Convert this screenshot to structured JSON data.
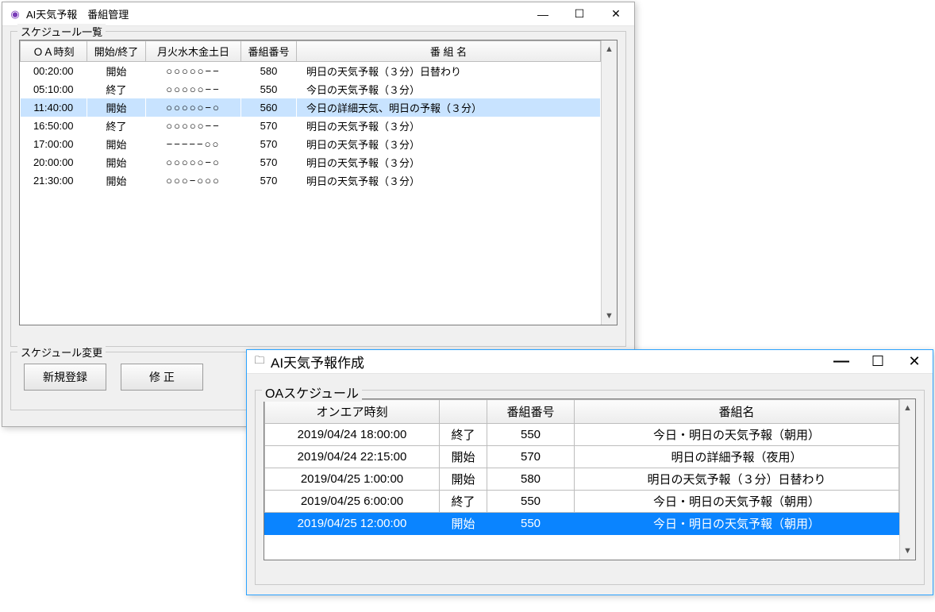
{
  "win1": {
    "title": "AI天気予報　番組管理",
    "group1_legend": "スケジュール一覧",
    "group2_legend": "スケジュール変更",
    "headers": {
      "time": "ＯＡ時刻",
      "se": "開始/終了",
      "days": "月火水木金土日",
      "pno": "番組番号",
      "pname": "番 組 名"
    },
    "rows": [
      {
        "time": "00:20:00",
        "se": "開始",
        "days": "○○○○○−−",
        "pno": "580",
        "pname": "明日の天気予報（３分）日替わり"
      },
      {
        "time": "05:10:00",
        "se": "終了",
        "days": "○○○○○−−",
        "pno": "550",
        "pname": "今日の天気予報（３分）"
      },
      {
        "time": "11:40:00",
        "se": "開始",
        "days": "○○○○○−○",
        "pno": "560",
        "pname": "今日の詳細天気、明日の予報（３分）"
      },
      {
        "time": "16:50:00",
        "se": "終了",
        "days": "○○○○○−−",
        "pno": "570",
        "pname": "明日の天気予報（３分）"
      },
      {
        "time": "17:00:00",
        "se": "開始",
        "days": "−−−−−○○",
        "pno": "570",
        "pname": "明日の天気予報（３分）"
      },
      {
        "time": "20:00:00",
        "se": "開始",
        "days": "○○○○○−○",
        "pno": "570",
        "pname": "明日の天気予報（３分）"
      },
      {
        "time": "21:30:00",
        "se": "開始",
        "days": "○○○−○○○",
        "pno": "570",
        "pname": "明日の天気予報（３分）"
      }
    ],
    "selected_row_index": 2,
    "buttons": {
      "new": "新規登録",
      "edit": "修 正"
    }
  },
  "win2": {
    "title": "AI天気予報作成",
    "group_legend": "OAスケジュール",
    "headers": {
      "oat": "オンエア時刻",
      "se": "",
      "pno": "番組番号",
      "pname": "番組名"
    },
    "rows": [
      {
        "oat": "2019/04/24 18:00:00",
        "se": "終了",
        "pno": "550",
        "pname": "今日・明日の天気予報（朝用）"
      },
      {
        "oat": "2019/04/24 22:15:00",
        "se": "開始",
        "pno": "570",
        "pname": "明日の詳細予報（夜用）"
      },
      {
        "oat": "2019/04/25 1:00:00",
        "se": "開始",
        "pno": "580",
        "pname": "明日の天気予報（３分）日替わり"
      },
      {
        "oat": "2019/04/25 6:00:00",
        "se": "終了",
        "pno": "550",
        "pname": "今日・明日の天気予報（朝用）"
      },
      {
        "oat": "2019/04/25 12:00:00",
        "se": "開始",
        "pno": "550",
        "pname": "今日・明日の天気予報（朝用）"
      }
    ],
    "highlight_row_index": 4
  },
  "glyphs": {
    "min": "—",
    "max": "☐",
    "close": "✕",
    "folder": "🗀",
    "appicon": "◉",
    "up": "▲",
    "down": "▼"
  }
}
